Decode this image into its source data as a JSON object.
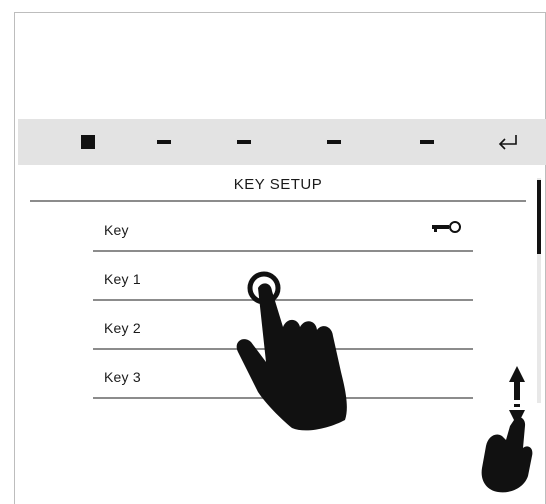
{
  "screen": {
    "title": "KEY SETUP"
  },
  "softkeys": [
    {
      "icon": "stop-square-icon"
    },
    {
      "icon": "dash-icon"
    },
    {
      "icon": "dash-icon"
    },
    {
      "icon": "dash-icon"
    },
    {
      "icon": "dash-icon"
    },
    {
      "icon": "enter-return-icon"
    }
  ],
  "list": {
    "items": [
      {
        "label": "Key",
        "icon": "key-icon"
      },
      {
        "label": "Key 1"
      },
      {
        "label": "Key 2"
      },
      {
        "label": "Key 3"
      }
    ]
  },
  "gestures": {
    "tap": "tap-hand-icon",
    "swipe": "swipe-vertical-hand-icon"
  }
}
